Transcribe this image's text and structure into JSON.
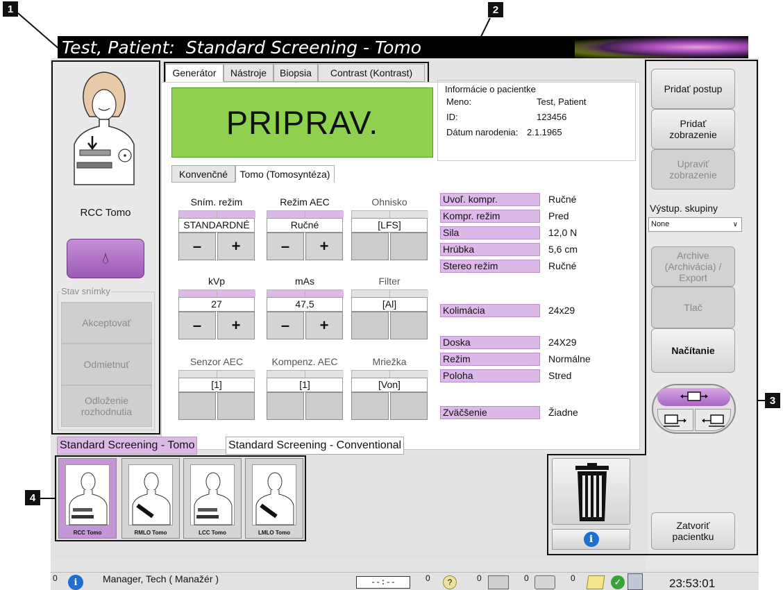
{
  "callouts": [
    "1",
    "2",
    "3",
    "4"
  ],
  "title": "Test, Patient:  Standard Screening - Tomo",
  "left_panel": {
    "view_name": "RCC Tomo",
    "group_label": "Stav snímky",
    "buttons": [
      "Akceptovať",
      "Odmietnuť",
      "Odloženie\nrozhodnutia"
    ]
  },
  "tabs": [
    "Generátor",
    "Nástroje",
    "Biopsia",
    "Contrast (Kontrast)"
  ],
  "ready_text": "PRIPRAV.",
  "patient_info": {
    "legend": "Informácie o pacientke",
    "rows": [
      {
        "label": "Meno:",
        "value": "Test, Patient"
      },
      {
        "label": "ID:",
        "value": "123456"
      },
      {
        "label": "Dátum narodenia:",
        "value": "2.1.1965"
      }
    ]
  },
  "subtabs": [
    "Konvenčné",
    "Tomo (Tomosyntéza)"
  ],
  "controls": [
    {
      "label": "Sním. režim",
      "value": "STANDARDNÉ",
      "enabled": true
    },
    {
      "label": "Režim AEC",
      "value": "Ručné",
      "enabled": true
    },
    {
      "label": "Ohnisko",
      "value": "[LFS]",
      "enabled": false
    },
    {
      "label": "kVp",
      "value": "27",
      "enabled": true
    },
    {
      "label": "mAs",
      "value": "47,5",
      "enabled": true
    },
    {
      "label": "Filter",
      "value": "[Al]",
      "enabled": false
    },
    {
      "label": "Senzor AEC",
      "value": "[1]",
      "enabled": false
    },
    {
      "label": "Kompenz. AEC",
      "value": "[1]",
      "enabled": false
    },
    {
      "label": "Mriežka",
      "value": "[Von]",
      "enabled": false
    }
  ],
  "plus_minus": [
    "–",
    "+"
  ],
  "properties": [
    {
      "label": "Uvoľ. kompr.",
      "value": "Ručné"
    },
    {
      "label": "Kompr. režim",
      "value": "Pred"
    },
    {
      "label": "Sila",
      "value": "12,0 N"
    },
    {
      "label": "Hrúbka",
      "value": "5,6 cm"
    },
    {
      "label": "Stereo režim",
      "value": "Ručné"
    },
    {
      "label": "Kolimácia",
      "value": "24x29"
    },
    {
      "label": "Doska",
      "value": "24X29"
    },
    {
      "label": "Režim",
      "value": "Normálne"
    },
    {
      "label": "Poloha",
      "value": "Stred"
    },
    {
      "label": "Zväčšenie",
      "value": "Žiadne"
    }
  ],
  "right_panel": {
    "add_procedure": "Pridať postup",
    "add_view": "Pridať\nzobrazenie",
    "edit_view": "Upraviť\nzobrazenie",
    "output_label": "Výstup. skupiny",
    "output_value": "None",
    "archive": "Archive\n(Archivácia) /\nExport",
    "print": "Tlač",
    "load": "Načítanie",
    "close_patient": "Zatvoriť\npacientku"
  },
  "procedure_tabs": [
    "Standard Screening - Tomo",
    "Standard Screening - Conventional"
  ],
  "thumbnails": [
    "RCC Tomo",
    "RMLO Tomo",
    "LCC Tomo",
    "LMLO Tomo"
  ],
  "status": {
    "count_user": "0",
    "user": "Manager, Tech ( Manažér )",
    "timer": "--:--",
    "counts": [
      "0",
      "0",
      "0",
      "0"
    ],
    "time": "23:53:01"
  },
  "colors": {
    "ready_green": "#8fd14f",
    "accent_purple": "#ddb9ea",
    "button_purple": "#9b59b6"
  }
}
